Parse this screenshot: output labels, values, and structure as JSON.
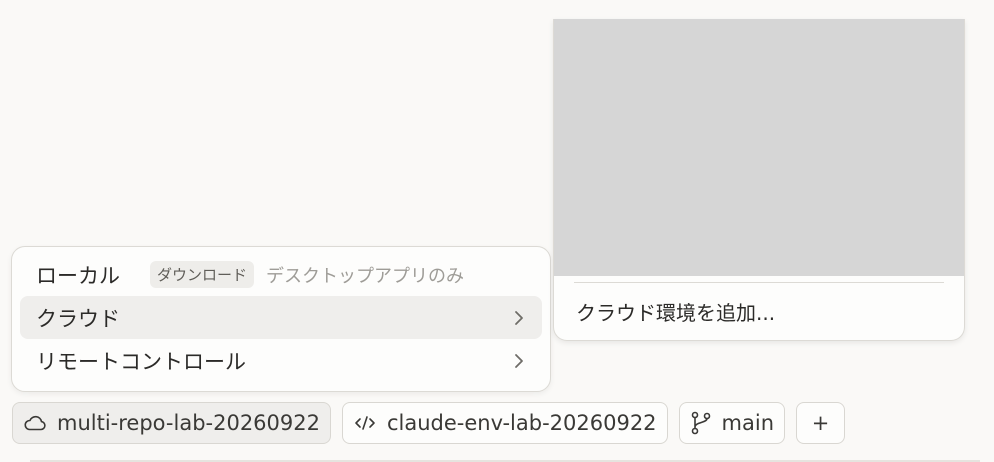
{
  "menu": {
    "items": [
      {
        "label": "ローカル",
        "badge": "ダウンロード",
        "note": "デスクトップアプリのみ"
      },
      {
        "label": "クラウド",
        "chevron_icon": "chevron-right-icon"
      },
      {
        "label": "リモートコントロール",
        "chevron_icon": "chevron-right-icon"
      }
    ]
  },
  "submenu": {
    "add_label": "クラウド環境を追加..."
  },
  "bottom_bar": {
    "environment": {
      "icon": "cloud-icon",
      "label": "multi-repo-lab-20260922"
    },
    "repo": {
      "icon": "code-icon",
      "label": "claude-env-lab-20260922"
    },
    "branch": {
      "icon": "git-branch-icon",
      "label": "main"
    },
    "add": {
      "icon": "plus-icon",
      "label": "+"
    }
  },
  "colors": {
    "background": "#faf9f7",
    "active_row": "#efeeec",
    "muted_text": "#9e9c97",
    "placeholder": "#d6d6d6"
  }
}
